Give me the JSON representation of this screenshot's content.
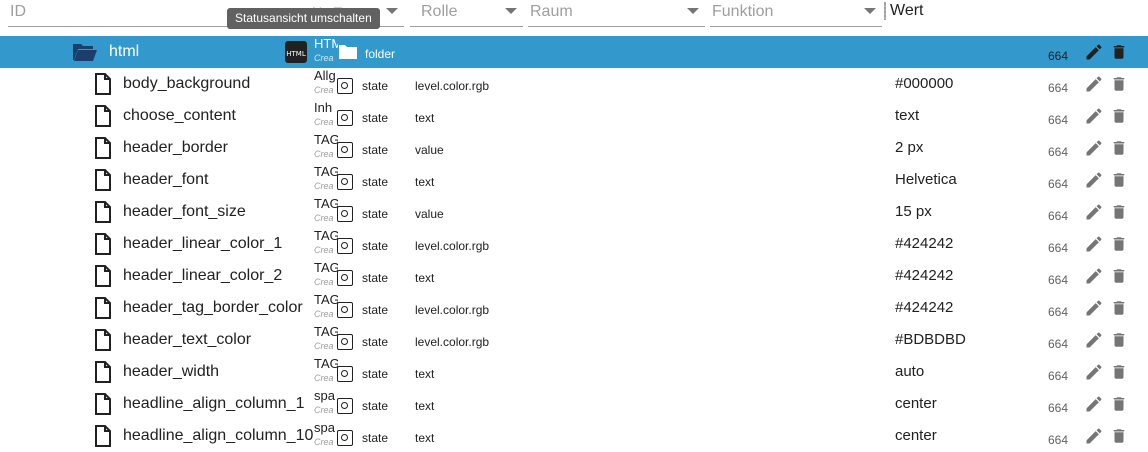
{
  "filters": {
    "id_placeholder": "ID",
    "name_placeholder": "Na Ty",
    "role_placeholder": "Rolle",
    "room_placeholder": "Raum",
    "function_placeholder": "Funktion",
    "value_header": "Wert"
  },
  "tooltip": "Statusansicht umschalten",
  "folder_row": {
    "name": "html",
    "name_col": "HTM",
    "name_col_sub": "Crea",
    "type": "folder",
    "acl": "664",
    "html_badge": "HTML"
  },
  "rows": [
    {
      "name": "body_background",
      "name_col": "Allg",
      "sub": "Crea",
      "type": "state",
      "role": "level.color.rgb",
      "value": "#000000",
      "acl": "664"
    },
    {
      "name": "choose_content",
      "name_col": "Inh",
      "sub": "Crea",
      "type": "state",
      "role": "text",
      "value": "text",
      "acl": "664"
    },
    {
      "name": "header_border",
      "name_col": "TAG",
      "sub": "Crea",
      "type": "state",
      "role": "value",
      "value": "2 px",
      "acl": "664"
    },
    {
      "name": "header_font",
      "name_col": "TAG",
      "sub": "Crea",
      "type": "state",
      "role": "text",
      "value": "Helvetica",
      "acl": "664"
    },
    {
      "name": "header_font_size",
      "name_col": "TAG",
      "sub": "Crea",
      "type": "state",
      "role": "value",
      "value": "15 px",
      "acl": "664"
    },
    {
      "name": "header_linear_color_1",
      "name_col": "TAG",
      "sub": "Crea",
      "type": "state",
      "role": "level.color.rgb",
      "value": "#424242",
      "acl": "664"
    },
    {
      "name": "header_linear_color_2",
      "name_col": "TAG",
      "sub": "Crea",
      "type": "state",
      "role": "text",
      "value": "#424242",
      "acl": "664"
    },
    {
      "name": "header_tag_border_color",
      "name_col": "TAG",
      "sub": "Crea",
      "type": "state",
      "role": "level.color.rgb",
      "value": "#424242",
      "acl": "664"
    },
    {
      "name": "header_text_color",
      "name_col": "TAG",
      "sub": "Crea",
      "type": "state",
      "role": "level.color.rgb",
      "value": "#BDBDBD",
      "acl": "664"
    },
    {
      "name": "header_width",
      "name_col": "TAG",
      "sub": "Crea",
      "type": "state",
      "role": "text",
      "value": "auto",
      "acl": "664"
    },
    {
      "name": "headline_align_column_1",
      "name_col": "spa",
      "sub": "Crea",
      "type": "state",
      "role": "text",
      "value": "center",
      "acl": "664"
    },
    {
      "name": "headline_align_column_10",
      "name_col": "spa",
      "sub": "Crea",
      "type": "state",
      "role": "text",
      "value": "center",
      "acl": "664"
    }
  ],
  "colors": {
    "selected_row": "#3399cc",
    "icon_grey": "#757575"
  },
  "icons": {
    "folder_open": "folder-open-icon",
    "file": "file-icon",
    "edit": "pencil-icon",
    "delete": "trash-icon"
  }
}
